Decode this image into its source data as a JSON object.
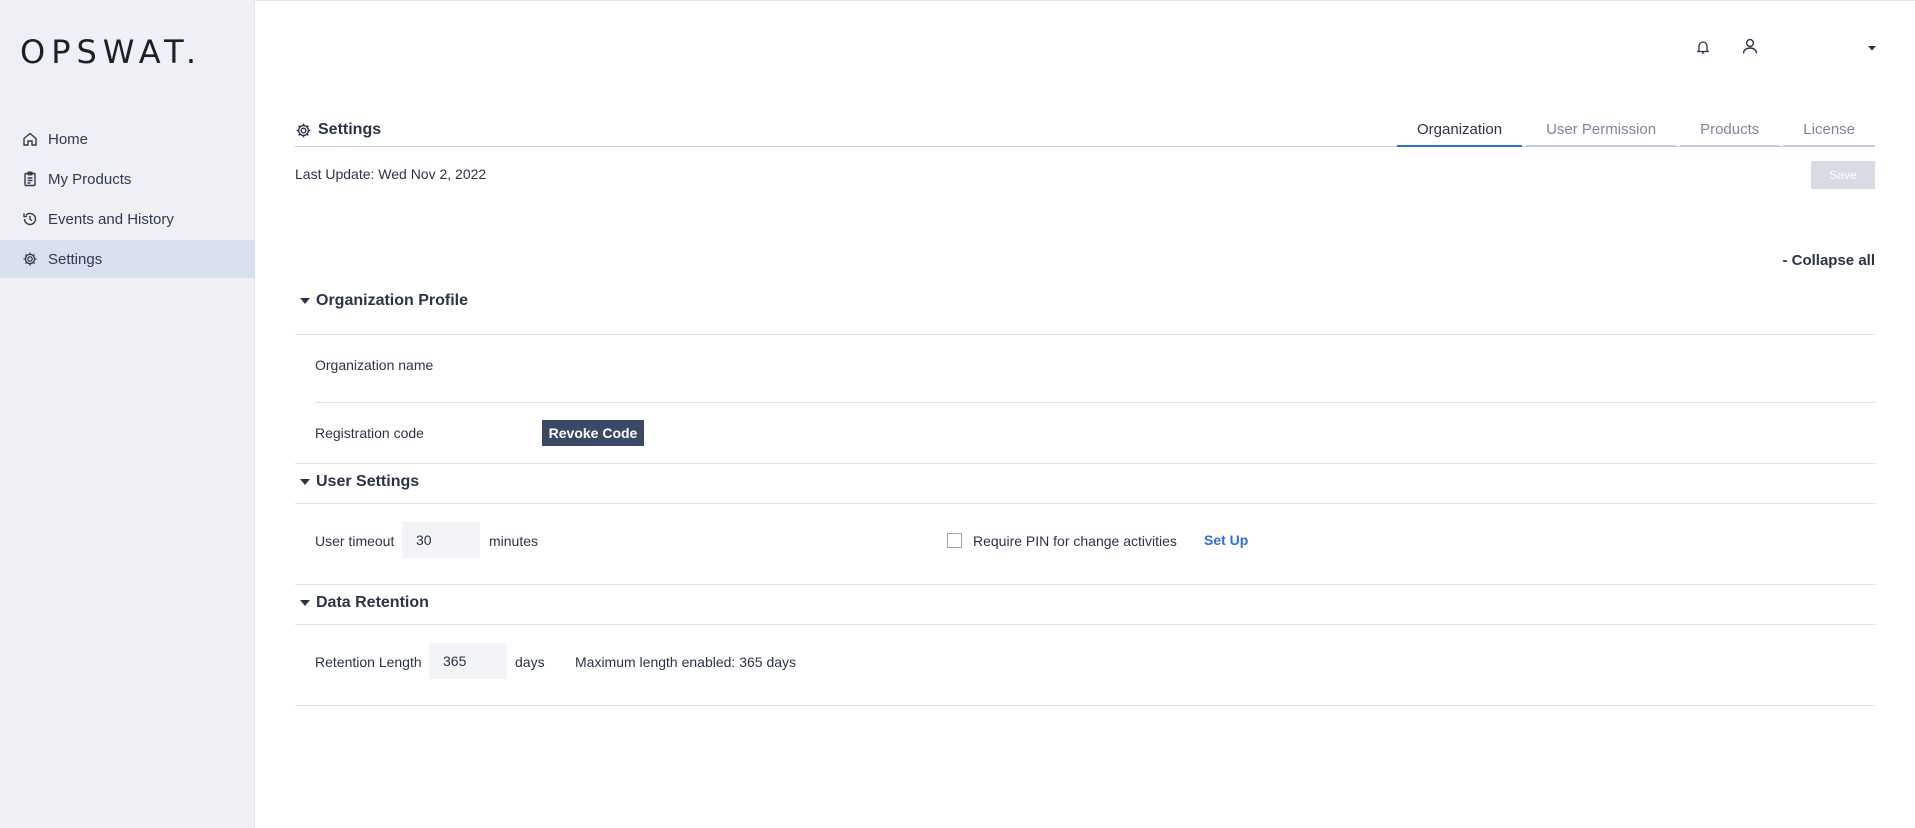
{
  "app": {
    "logo_text": "OPSWAT."
  },
  "sidebar": {
    "items": [
      {
        "label": "Home",
        "icon": "home-icon"
      },
      {
        "label": "My Products",
        "icon": "clipboard-icon"
      },
      {
        "label": "Events and History",
        "icon": "history-icon"
      },
      {
        "label": "Settings",
        "icon": "gear-icon",
        "active": true
      }
    ]
  },
  "header": {
    "icons": [
      "bell-icon",
      "user-icon",
      "chevron-down-icon"
    ]
  },
  "page": {
    "title": "Settings",
    "tabs": [
      "Organization",
      "User Permission",
      "Products",
      "License"
    ],
    "active_tab": "Organization",
    "last_update": "Last Update: Wed Nov 2, 2022",
    "save_label": "Save",
    "collapse_all": "- Collapse all"
  },
  "sections": {
    "org_profile": {
      "title": "Organization Profile",
      "org_name_label": "Organization name",
      "reg_code_label": "Registration code",
      "revoke_label": "Revoke Code"
    },
    "user_settings": {
      "title": "User Settings",
      "timeout_label": "User timeout",
      "timeout_value": "30",
      "timeout_unit": "minutes",
      "pin_label": "Require PIN for change activities",
      "pin_checked": false,
      "setup_label": "Set Up"
    },
    "data_retention": {
      "title": "Data Retention",
      "length_label": "Retention Length",
      "length_value": "365",
      "length_unit": "days",
      "max_note": "Maximum length enabled: 365 days"
    }
  },
  "colors": {
    "accent": "#2f6fd8",
    "sidebar_bg": "#eef0f5",
    "active_nav": "#d9dfee",
    "dark_button": "#3d4866"
  }
}
